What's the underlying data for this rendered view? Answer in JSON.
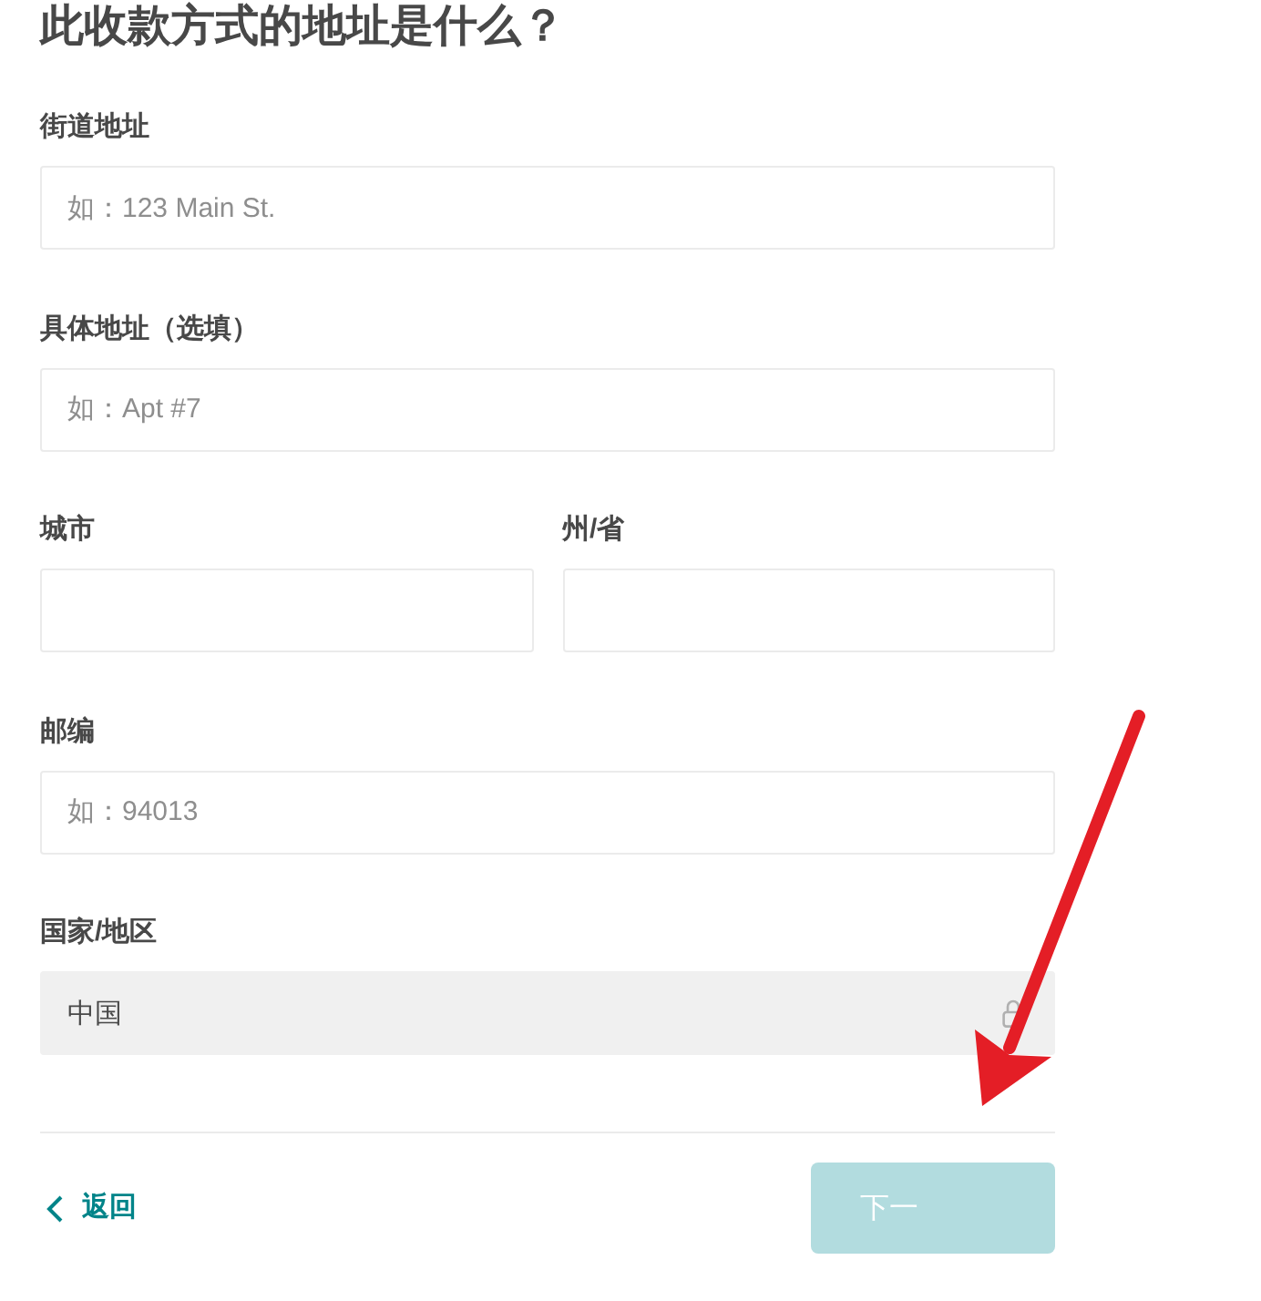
{
  "title": "此收款方式的地址是什么？",
  "rows": [
    {
      "fields": [
        {
          "label": "街道地址",
          "placeholder": "如：123 Main St.",
          "locked": false
        }
      ]
    },
    {
      "fields": [
        {
          "label": "具体地址（选填）",
          "placeholder": "如：Apt #7",
          "locked": false
        }
      ]
    },
    {
      "fields": [
        {
          "label": "城市",
          "locked": false
        },
        {
          "label": "州/省",
          "locked": false
        }
      ]
    },
    {
      "fields": [
        {
          "label": "邮编",
          "placeholder": "如：94013",
          "locked": false
        }
      ]
    },
    {
      "fields": [
        {
          "label": "国家/地区",
          "value": "中国",
          "locked": true
        }
      ]
    }
  ],
  "footer": {
    "back": {
      "label": "返回"
    },
    "next": {
      "label": "下一",
      "disabled": true
    }
  }
}
